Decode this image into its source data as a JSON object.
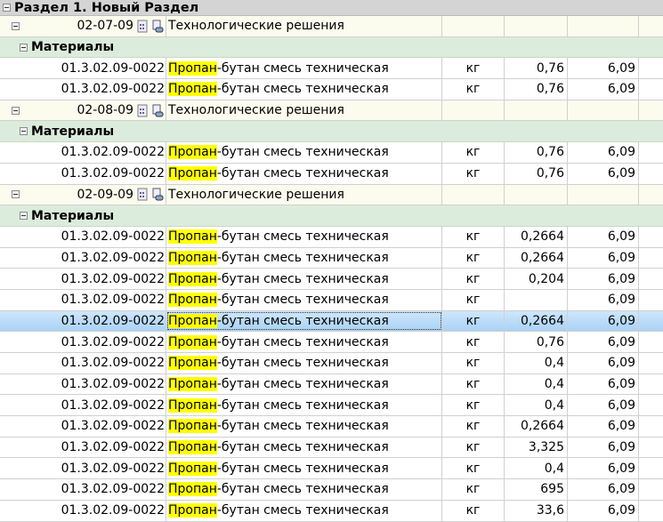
{
  "section": {
    "title": "Раздел 1. Новый Раздел"
  },
  "materials_label": "Материалы",
  "highlight": "Пропан",
  "groups": [
    {
      "code": "02-07-09",
      "title": "Технологические решения",
      "items": [
        {
          "code": "01.3.02.09-0022",
          "name_rest": "-бутан смесь техническая",
          "unit": "кг",
          "qty": "0,76",
          "price": "6,09"
        },
        {
          "code": "01.3.02.09-0022",
          "name_rest": "-бутан смесь техническая",
          "unit": "кг",
          "qty": "0,76",
          "price": "6,09"
        }
      ]
    },
    {
      "code": "02-08-09",
      "title": "Технологические решения",
      "items": [
        {
          "code": "01.3.02.09-0022",
          "name_rest": "-бутан смесь техническая",
          "unit": "кг",
          "qty": "0,76",
          "price": "6,09"
        },
        {
          "code": "01.3.02.09-0022",
          "name_rest": "-бутан смесь техническая",
          "unit": "кг",
          "qty": "0,76",
          "price": "6,09"
        }
      ]
    },
    {
      "code": "02-09-09",
      "title": "Технологические решения",
      "items": [
        {
          "code": "01.3.02.09-0022",
          "name_rest": "-бутан смесь техническая",
          "unit": "кг",
          "qty": "0,2664",
          "price": "6,09"
        },
        {
          "code": "01.3.02.09-0022",
          "name_rest": "-бутан смесь техническая",
          "unit": "кг",
          "qty": "0,2664",
          "price": "6,09"
        },
        {
          "code": "01.3.02.09-0022",
          "name_rest": "-бутан смесь техническая",
          "unit": "кг",
          "qty": "0,204",
          "price": "6,09"
        },
        {
          "code": "01.3.02.09-0022",
          "name_rest": "-бутан смесь техническая",
          "unit": "кг",
          "qty": "",
          "price": "6,09"
        },
        {
          "code": "01.3.02.09-0022",
          "name_rest": "-бутан смесь техническая",
          "unit": "кг",
          "qty": "0,2664",
          "price": "6,09",
          "selected": true
        },
        {
          "code": "01.3.02.09-0022",
          "name_rest": "-бутан смесь техническая",
          "unit": "кг",
          "qty": "0,76",
          "price": "6,09"
        },
        {
          "code": "01.3.02.09-0022",
          "name_rest": "-бутан смесь техническая",
          "unit": "кг",
          "qty": "0,4",
          "price": "6,09"
        },
        {
          "code": "01.3.02.09-0022",
          "name_rest": "-бутан смесь техническая",
          "unit": "кг",
          "qty": "0,4",
          "price": "6,09"
        },
        {
          "code": "01.3.02.09-0022",
          "name_rest": "-бутан смесь техническая",
          "unit": "кг",
          "qty": "0,4",
          "price": "6,09"
        },
        {
          "code": "01.3.02.09-0022",
          "name_rest": "-бутан смесь техническая",
          "unit": "кг",
          "qty": "0,2664",
          "price": "6,09"
        },
        {
          "code": "01.3.02.09-0022",
          "name_rest": "-бутан смесь техническая",
          "unit": "кг",
          "qty": "3,325",
          "price": "6,09"
        },
        {
          "code": "01.3.02.09-0022",
          "name_rest": "-бутан смесь техническая",
          "unit": "кг",
          "qty": "0,4",
          "price": "6,09"
        },
        {
          "code": "01.3.02.09-0022",
          "name_rest": "-бутан смесь техническая",
          "unit": "кг",
          "qty": "695",
          "price": "6,09"
        },
        {
          "code": "01.3.02.09-0022",
          "name_rest": "-бутан смесь техническая",
          "unit": "кг",
          "qty": "33,6",
          "price": "6,09"
        }
      ]
    }
  ]
}
